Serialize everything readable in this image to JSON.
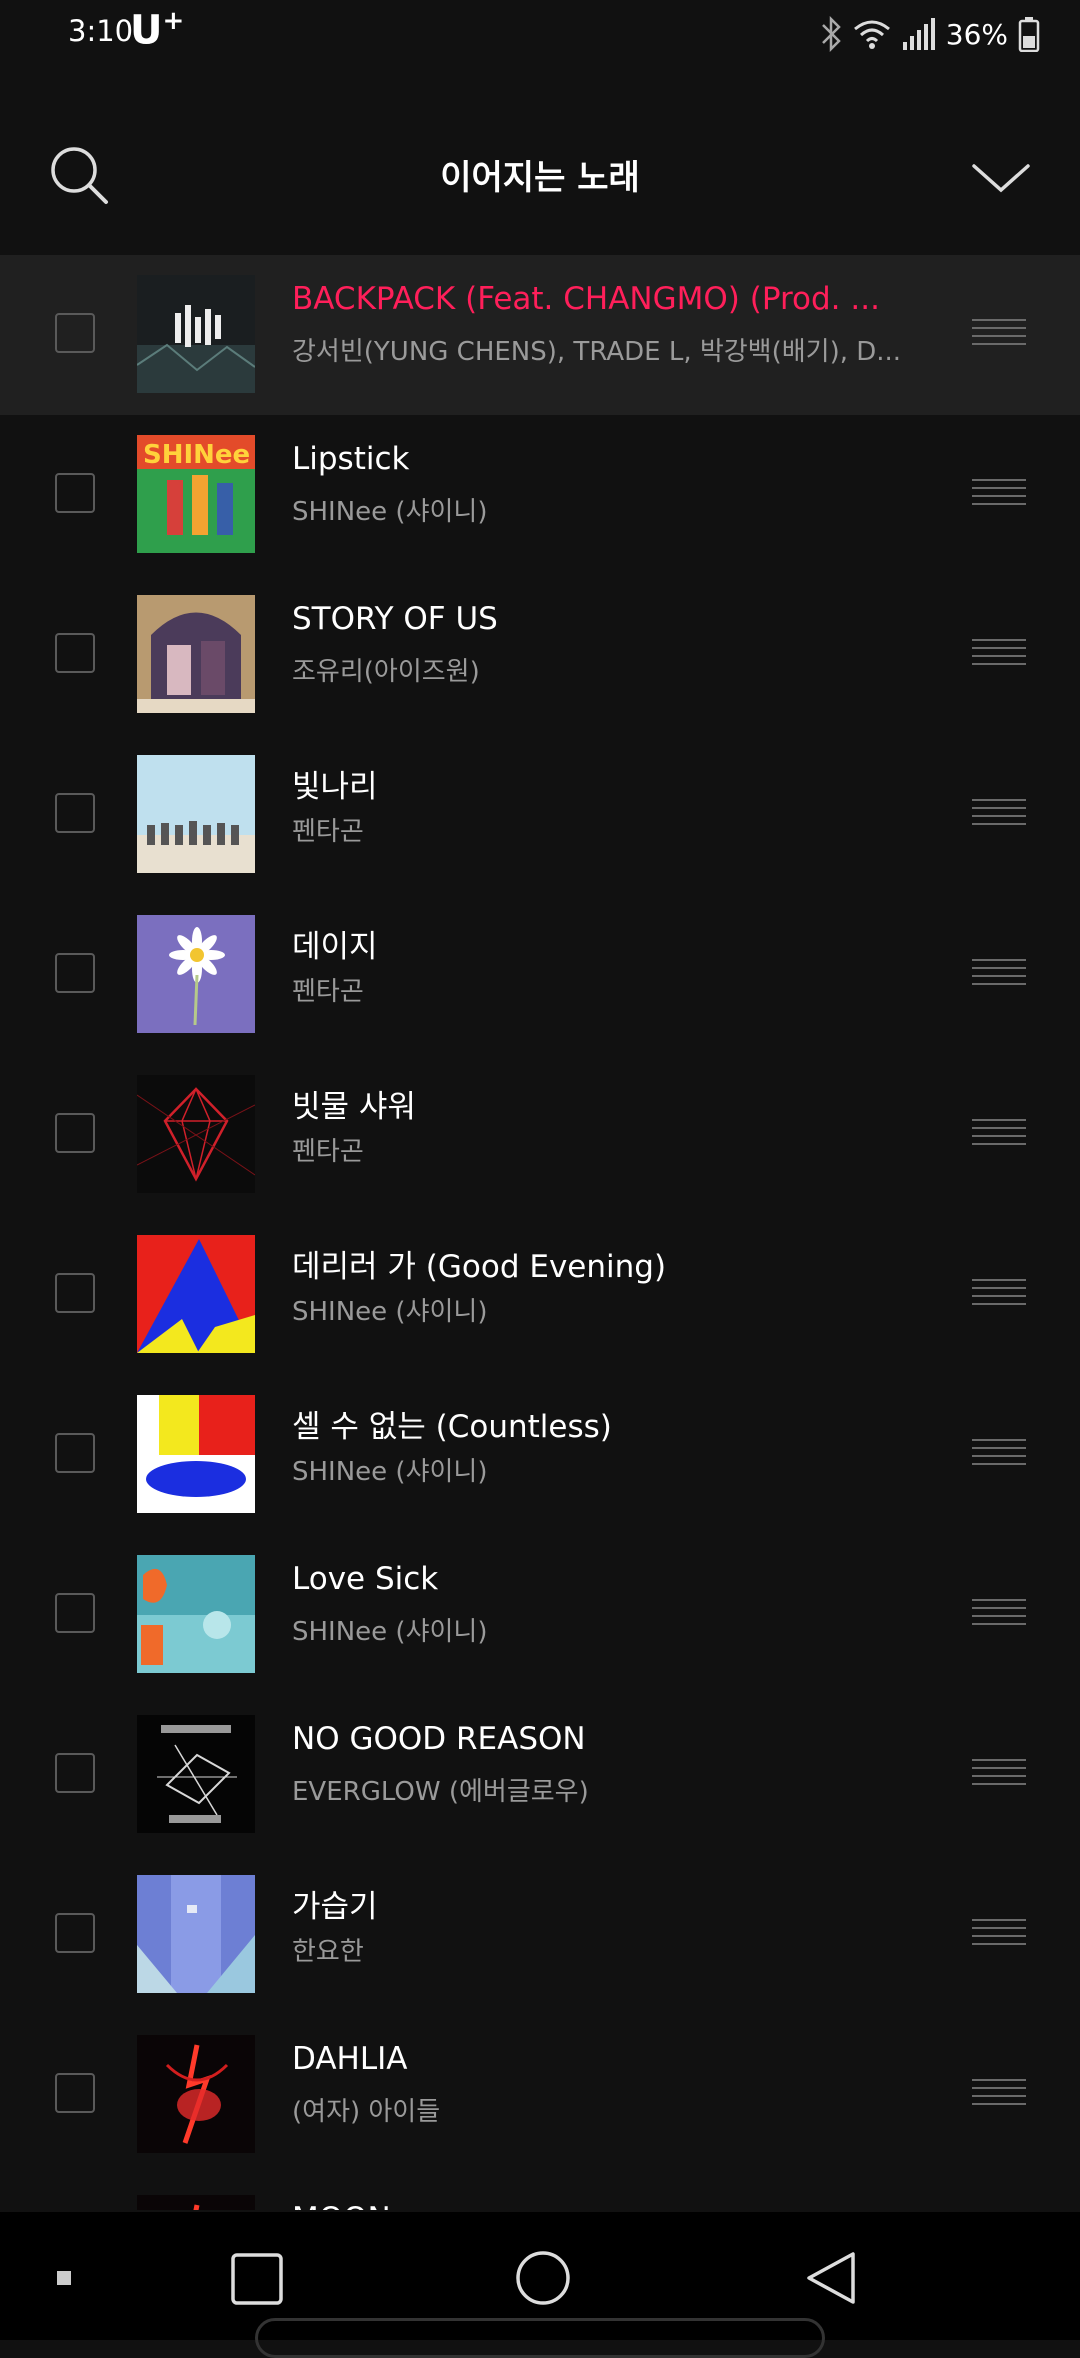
{
  "status_bar": {
    "time": "3:10",
    "carrier": "U",
    "carrier_sup": "+",
    "battery": "36%"
  },
  "header": {
    "title": "이어지는 노래"
  },
  "colors": {
    "accent": "#ff1f5a",
    "background": "#111111",
    "active_row": "#202020",
    "secondary_text": "#9a9a9a"
  },
  "tracks": [
    {
      "title": "BACKPACK (Feat. CHANGMO) (Prod. ...",
      "artist": "강서빈(YUNG CHENS), TRADE L, 박강백(배기), D...",
      "active": true
    },
    {
      "title": "Lipstick",
      "artist": "SHINee (샤이니)"
    },
    {
      "title": "STORY OF US",
      "artist": "조유리(아이즈원)"
    },
    {
      "title": "빛나리",
      "artist": "펜타곤"
    },
    {
      "title": "데이지",
      "artist": "펜타곤"
    },
    {
      "title": "빗물 샤워",
      "artist": "펜타곤"
    },
    {
      "title": "데리러 가 (Good Evening)",
      "artist": "SHINee (샤이니)"
    },
    {
      "title": "셀 수 없는 (Countless)",
      "artist": "SHINee (샤이니)"
    },
    {
      "title": "Love Sick",
      "artist": "SHINee (샤이니)"
    },
    {
      "title": "NO GOOD REASON",
      "artist": "EVERGLOW (에버글로우)"
    },
    {
      "title": "가습기",
      "artist": "한요한"
    },
    {
      "title": "DAHLIA",
      "artist": "(여자) 아이들"
    },
    {
      "title": "MOON",
      "artist": ""
    }
  ],
  "icons": {
    "search": "search-icon",
    "collapse": "chevron-down-icon",
    "drag": "drag-handle-icon",
    "nav_recent": "square-icon",
    "nav_home": "circle-icon",
    "nav_back": "triangle-back-icon"
  }
}
